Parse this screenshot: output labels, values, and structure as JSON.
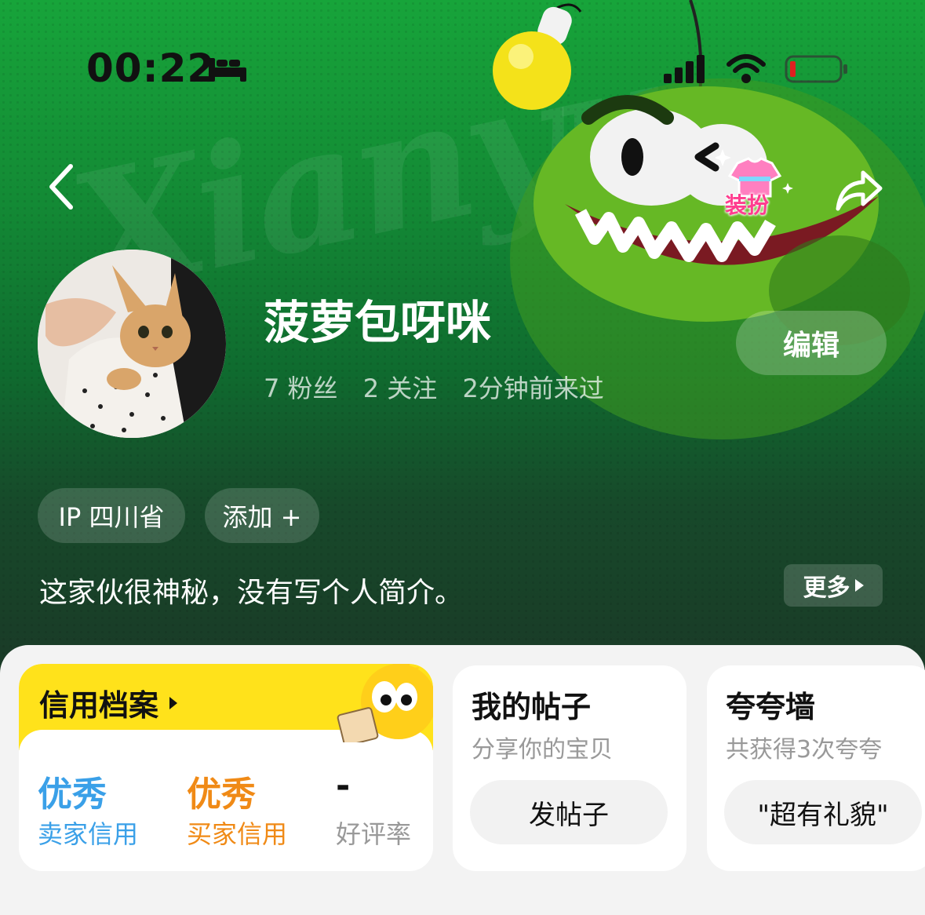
{
  "status_bar": {
    "time": "00:22"
  },
  "header": {
    "dressup_label": "装扮"
  },
  "profile": {
    "username": "菠萝包呀咪",
    "fans": "7 粉丝",
    "following": "2 关注",
    "last_seen": "2分钟前来过",
    "edit_label": "编辑",
    "ip_tag": "IP 四川省",
    "add_tag": "添加 +",
    "bio": "这家伙很神秘，没有写个人简介。",
    "more_label": "更多"
  },
  "credit": {
    "title": "信用档案",
    "seller_value": "优秀",
    "seller_label": "卖家信用",
    "buyer_value": "优秀",
    "buyer_label": "买家信用",
    "rating_value": "-",
    "rating_label": "好评率"
  },
  "posts": {
    "title": "我的帖子",
    "subtitle": "分享你的宝贝",
    "button": "发帖子"
  },
  "praise": {
    "title": "夸夸墙",
    "subtitle": "共获得3次夸夸",
    "button": "\"超有礼貌\""
  },
  "colors": {
    "seller": "#3aa0e8",
    "buyer": "#f08a16",
    "rating": "#999999",
    "band": "#ffe21b"
  }
}
